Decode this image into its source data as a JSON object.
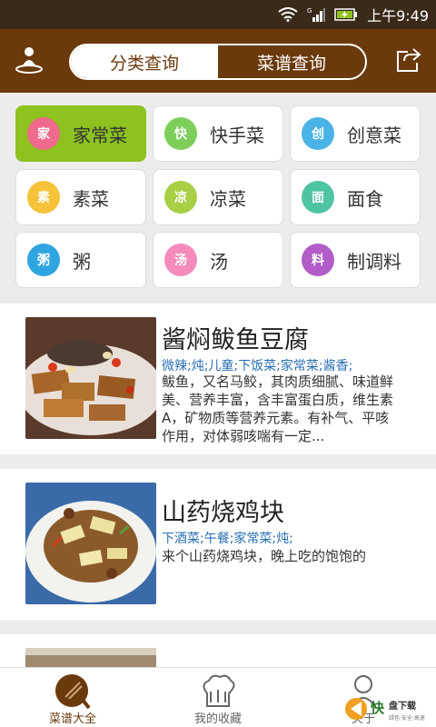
{
  "status_bar": {
    "time": "上午9:49"
  },
  "header": {
    "tabs": [
      {
        "label": "分类查询",
        "active": true
      },
      {
        "label": "菜谱查询",
        "active": false
      }
    ]
  },
  "categories": [
    {
      "label": "家常菜",
      "icon_char": "家",
      "color": "#f06a8d",
      "active": true
    },
    {
      "label": "快手菜",
      "icon_char": "快",
      "color": "#7dcf5a",
      "active": false
    },
    {
      "label": "创意菜",
      "icon_char": "创",
      "color": "#4ab3e6",
      "active": false
    },
    {
      "label": "素菜",
      "icon_char": "素",
      "color": "#f5c23a",
      "active": false
    },
    {
      "label": "凉菜",
      "icon_char": "凉",
      "color": "#a8cf45",
      "active": false
    },
    {
      "label": "面食",
      "icon_char": "面",
      "color": "#4ec4a3",
      "active": false
    },
    {
      "label": "粥",
      "icon_char": "粥",
      "color": "#2fa5e0",
      "active": false
    },
    {
      "label": "汤",
      "icon_char": "汤",
      "color": "#f58bbb",
      "active": false
    },
    {
      "label": "制调料",
      "icon_char": "料",
      "color": "#b15cc7",
      "active": false
    }
  ],
  "recipes": [
    {
      "title": "酱焖鲅鱼豆腐",
      "tags": "微辣;炖;儿童;下饭菜;家常菜;酱香;",
      "desc": "鲅鱼，又名马鲛，其肉质细腻、味道鲜美、营养丰富，含丰富蛋白质，维生素A，矿物质等营养元素。有补气、平咳作用，对体弱咳喘有一定..."
    },
    {
      "title": "山药烧鸡块",
      "tags": "下酒菜;午餐;家常菜;炖;",
      "desc": "来个山药烧鸡块，晚上吃的饱饱的"
    }
  ],
  "bottom_nav": [
    {
      "label": "菜谱大全",
      "active": true
    },
    {
      "label": "我的收藏",
      "active": false
    },
    {
      "label": "关于",
      "active": false
    }
  ],
  "colors": {
    "header": "#6b3a0c",
    "accent_green": "#8dc21f",
    "tag_blue": "#2a6fb5"
  }
}
